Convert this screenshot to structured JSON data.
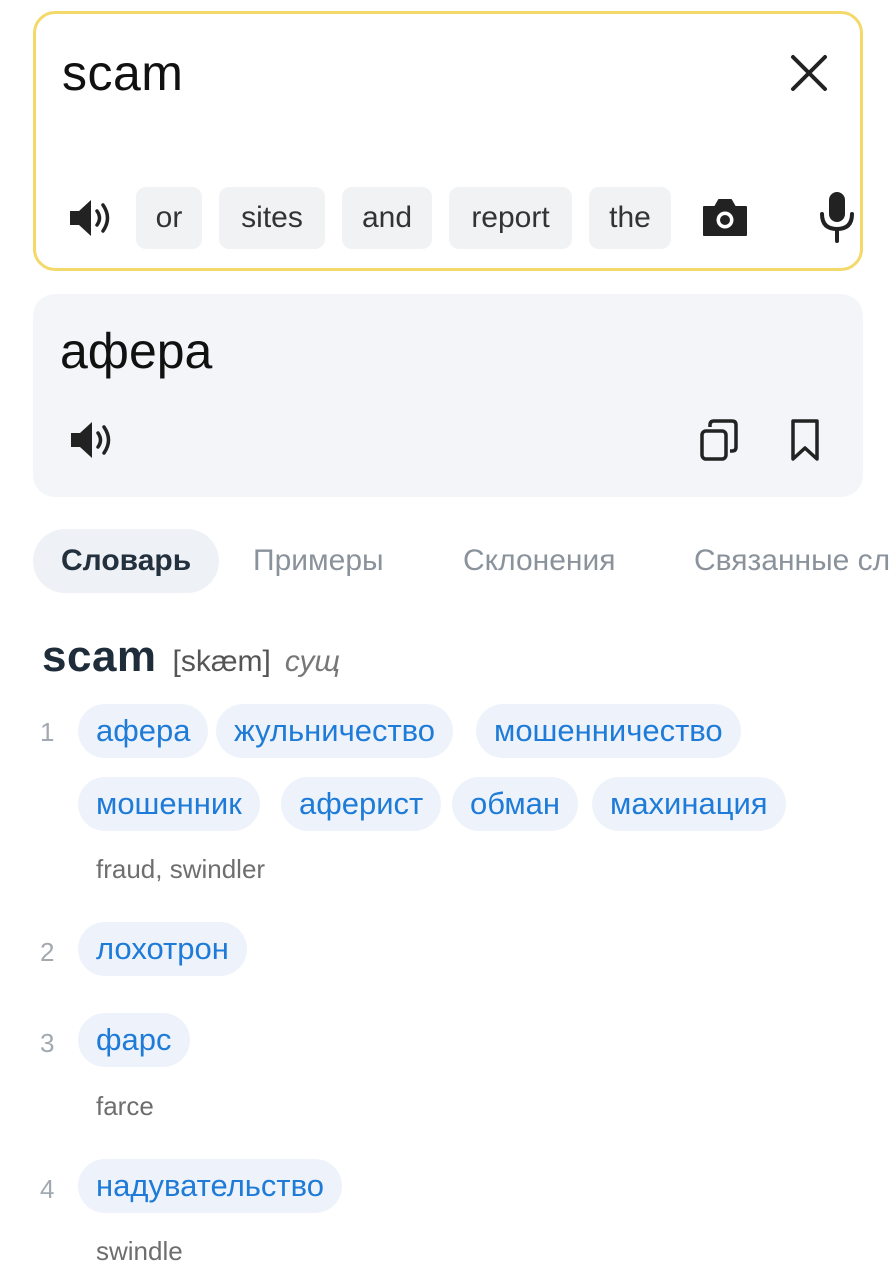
{
  "source": {
    "text": "scam",
    "suggestions": [
      "or",
      "sites",
      "and",
      "report",
      "the"
    ]
  },
  "target": {
    "text": "афера"
  },
  "tabs": [
    "Словарь",
    "Примеры",
    "Склонения",
    "Связанные сл"
  ],
  "dictionary": {
    "headword": "scam",
    "transcription": "[skæm]",
    "pos": "сущ",
    "senses": [
      {
        "num": "1",
        "translations": [
          "афера",
          "жульничество",
          "мошенничество",
          "мошенник",
          "аферист",
          "обман",
          "махинация"
        ],
        "gloss": "fraud, swindler"
      },
      {
        "num": "2",
        "translations": [
          "лохотрон"
        ],
        "gloss": ""
      },
      {
        "num": "3",
        "translations": [
          "фарс"
        ],
        "gloss": "farce"
      },
      {
        "num": "4",
        "translations": [
          "надувательство"
        ],
        "gloss": "swindle"
      }
    ]
  },
  "icons": {
    "clear": "close-icon",
    "speaker": "speaker-icon",
    "camera": "camera-icon",
    "mic": "microphone-icon",
    "copy": "copy-icon",
    "bookmark": "bookmark-icon"
  },
  "colors": {
    "source_border": "#f3d96a",
    "link_blue": "#1e7bd7",
    "chip_bg": "#eef3fb"
  }
}
